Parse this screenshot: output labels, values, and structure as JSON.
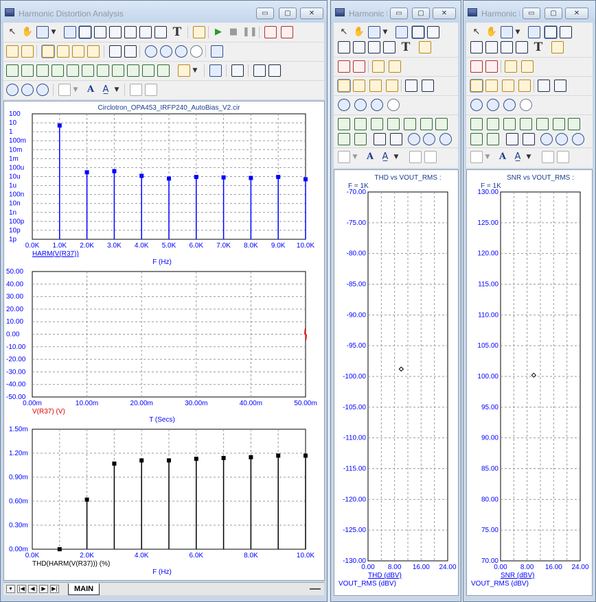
{
  "colors": {
    "blue": "#0000ff",
    "red": "#dd0000",
    "black": "#000000",
    "grid": "#999999",
    "title_blue": "#1b3c8f"
  },
  "windows": [
    {
      "title": "Harmonic Distortion Analysis",
      "controls": [
        "▭",
        "▢",
        "✕"
      ]
    },
    {
      "title": "Harmonic Distortion Analysis",
      "controls": [
        "▭",
        "▢",
        "✕"
      ]
    },
    {
      "title": "Harmonic Distortion Analysis",
      "controls": [
        "▭",
        "▢",
        "✕"
      ]
    }
  ],
  "status_bar": {
    "tab_label": "MAIN",
    "nav_buttons": [
      "▾",
      "|◀",
      "◀",
      "▶",
      "▶|"
    ]
  },
  "toolbar_text_glyphs": {
    "text_tool": "T",
    "font_tool": "A"
  },
  "chart_data": [
    {
      "type": "bar",
      "title": "Circlotron_OPA453_IRFP240_AutoBias_V2.cir",
      "xlabel": "F (Hz)",
      "series_label": "HARM(V(R37))",
      "y_scale": "log",
      "y_tick_labels": [
        "100",
        "10",
        "1",
        "100m",
        "10m",
        "1m",
        "100u",
        "10u",
        "1u",
        "100n",
        "10n",
        "1n",
        "100p",
        "10p",
        "1p"
      ],
      "x_tick_labels": [
        "0.0K",
        "1.0K",
        "2.0K",
        "3.0K",
        "4.0K",
        "5.0K",
        "6.0K",
        "7.0K",
        "8.0K",
        "9.0K",
        "10.0K"
      ],
      "xlim": [
        0,
        10000
      ],
      "x": [
        1000,
        2000,
        3000,
        4000,
        5000,
        6000,
        7000,
        8000,
        9000,
        10000
      ],
      "values": [
        5.0,
        3e-05,
        4e-05,
        1.2e-05,
        6e-06,
        9e-06,
        8e-06,
        7e-06,
        9e-06,
        5e-06
      ],
      "color": "#0000ff"
    },
    {
      "type": "line",
      "xlabel": "T (Secs)",
      "series_label": "V(R37) (V)",
      "ylim": [
        -50,
        50
      ],
      "xlim": [
        0,
        0.05
      ],
      "y_tick_labels": [
        "50.00",
        "40.00",
        "30.00",
        "20.00",
        "10.00",
        "0.00",
        "-10.00",
        "-20.00",
        "-30.00",
        "-40.00",
        "-50.00"
      ],
      "x_tick_labels": [
        "0.00m",
        "10.00m",
        "20.00m",
        "30.00m",
        "40.00m",
        "50.00m"
      ],
      "note_trace": "short waveform visible only near 50.00m",
      "color": "#dd0000"
    },
    {
      "type": "bar",
      "xlabel": "F (Hz)",
      "series_label": "THD(HARM(V(R37))) (%)",
      "ylim": [
        0,
        0.0015
      ],
      "xlim": [
        0,
        10000
      ],
      "y_tick_labels": [
        "1.50m",
        "1.20m",
        "0.90m",
        "0.60m",
        "0.30m",
        "0.00m"
      ],
      "x_tick_labels": [
        "0.0K",
        "2.0K",
        "4.0K",
        "6.0K",
        "8.0K",
        "10.0K"
      ],
      "x": [
        1000,
        2000,
        3000,
        4000,
        5000,
        6000,
        7000,
        8000,
        9000,
        10000
      ],
      "values": [
        0.0,
        0.00062,
        0.00107,
        0.00111,
        0.00111,
        0.00113,
        0.00114,
        0.00115,
        0.00117,
        0.00117
      ],
      "color": "#000000"
    },
    {
      "type": "scatter",
      "title": "THD vs VOUT_RMS :",
      "subtitle": "F = 1K",
      "xlabel": "VOUT_RMS (dBV)",
      "series_label": "THD (dBV)",
      "ylim": [
        -130,
        -70
      ],
      "xlim": [
        0,
        24
      ],
      "y_tick_labels": [
        "-70.00",
        "-75.00",
        "-80.00",
        "-85.00",
        "-90.00",
        "-95.00",
        "-100.00",
        "-105.00",
        "-110.00",
        "-115.00",
        "-120.00",
        "-125.00",
        "-130.00"
      ],
      "x_tick_labels": [
        "0.00",
        "8.00",
        "16.00",
        "24.00"
      ],
      "points": [
        {
          "x": 10.0,
          "y": -98.8
        }
      ],
      "color": "#000000"
    },
    {
      "type": "scatter",
      "title": "SNR vs VOUT_RMS :",
      "subtitle": "F = 1K",
      "xlabel": "VOUT_RMS (dBV)",
      "series_label": "SNR (dBV)",
      "ylim": [
        70,
        130
      ],
      "xlim": [
        0,
        24
      ],
      "y_tick_labels": [
        "130.00",
        "125.00",
        "120.00",
        "115.00",
        "110.00",
        "105.00",
        "100.00",
        "95.00",
        "90.00",
        "85.00",
        "80.00",
        "75.00",
        "70.00"
      ],
      "x_tick_labels": [
        "0.00",
        "8.00",
        "16.00",
        "24.00"
      ],
      "points": [
        {
          "x": 10.0,
          "y": 100.2
        }
      ],
      "color": "#000000"
    }
  ]
}
